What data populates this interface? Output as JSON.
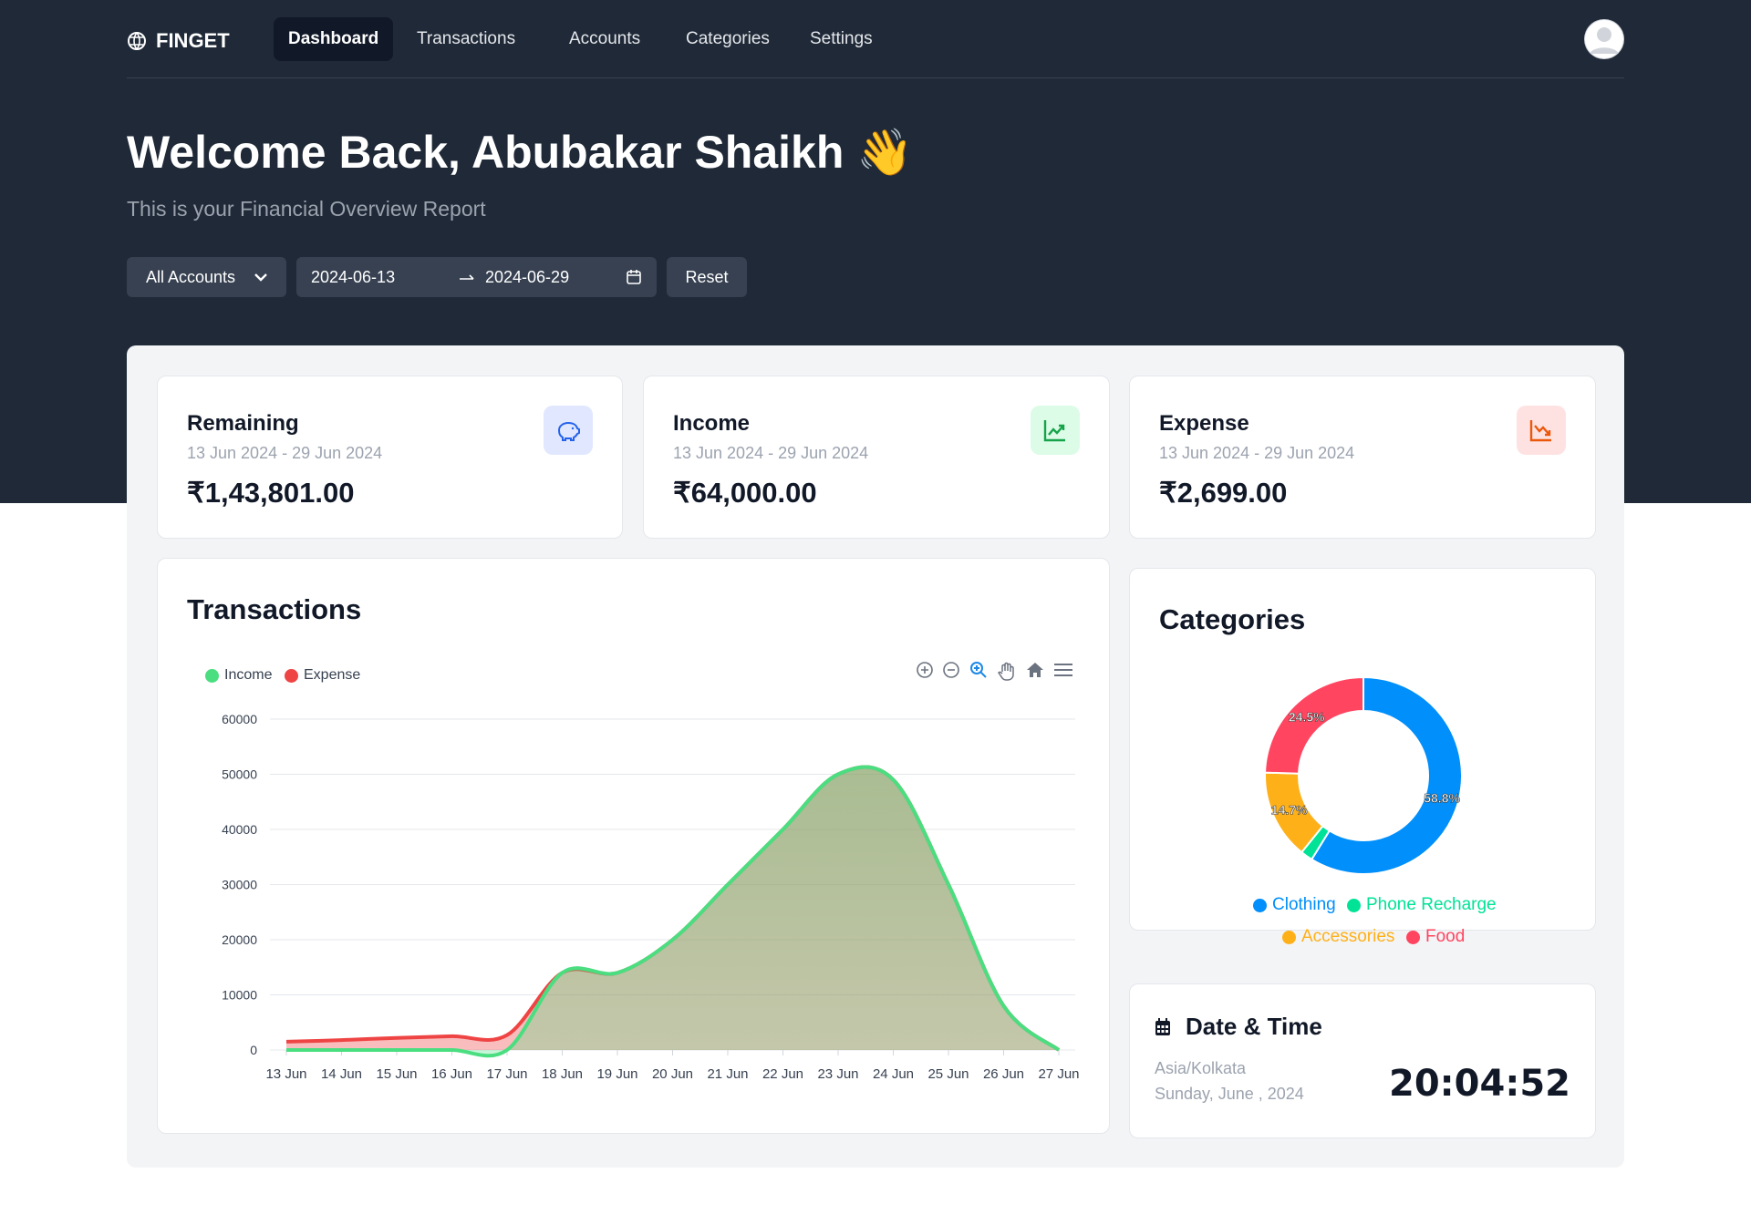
{
  "app": {
    "name": "FINGET"
  },
  "nav": {
    "items": [
      "Dashboard",
      "Transactions",
      "Accounts",
      "Categories",
      "Settings"
    ],
    "active": "Dashboard"
  },
  "header": {
    "title": "Welcome Back, Abubakar Shaikh 👋",
    "subtitle": "This is your Financial Overview Report"
  },
  "filters": {
    "account": "All Accounts",
    "start_date": "2024-06-13",
    "end_date": "2024-06-29",
    "reset_label": "Reset"
  },
  "stats": [
    {
      "title": "Remaining",
      "range": "13 Jun 2024 - 29 Jun 2024",
      "value": "₹1,43,801.00",
      "icon": "piggy-bank-icon",
      "color": "#2563eb",
      "bg": "#e0e7ff"
    },
    {
      "title": "Income",
      "range": "13 Jun 2024 - 29 Jun 2024",
      "value": "₹64,000.00",
      "icon": "trending-up-icon",
      "color": "#16a34a",
      "bg": "#dcfce7"
    },
    {
      "title": "Expense",
      "range": "13 Jun 2024 - 29 Jun 2024",
      "value": "₹2,699.00",
      "icon": "trending-down-icon",
      "color": "#ea580c",
      "bg": "#fee2e2"
    }
  ],
  "transactions": {
    "title": "Transactions"
  },
  "categories": {
    "title": "Categories"
  },
  "datetime": {
    "title": "Date & Time",
    "timezone": "Asia/Kolkata",
    "date": "Sunday, June , 2024",
    "time": "20:04:52"
  },
  "chart_data": [
    {
      "type": "area",
      "title": "",
      "x": [
        "13 Jun",
        "14 Jun",
        "15 Jun",
        "16 Jun",
        "17 Jun",
        "18 Jun",
        "19 Jun",
        "20 Jun",
        "21 Jun",
        "22 Jun",
        "23 Jun",
        "24 Jun",
        "25 Jun",
        "26 Jun",
        "27 Jun"
      ],
      "series": [
        {
          "name": "Income",
          "color": "#4ade80",
          "values": [
            0,
            0,
            0,
            0,
            0,
            14000,
            14000,
            20000,
            30000,
            40000,
            50000,
            49000,
            30000,
            8000,
            0
          ]
        },
        {
          "name": "Expense",
          "color": "#ef4444",
          "values": [
            1500,
            1800,
            2200,
            2500,
            2700,
            14000,
            14000,
            20000,
            30000,
            40000,
            50000,
            49000,
            30000,
            8000,
            0
          ]
        }
      ],
      "yticks": [
        0,
        10000,
        20000,
        30000,
        40000,
        50000,
        60000
      ],
      "ylim": [
        0,
        60000
      ],
      "grid": true,
      "legend": "top-left"
    },
    {
      "type": "pie",
      "donut": true,
      "title": "",
      "slices": [
        {
          "label": "Clothing",
          "value": 58.8,
          "color": "#008ffb",
          "text": "58.8%"
        },
        {
          "label": "Phone Recharge",
          "value": 2.0,
          "color": "#00e396",
          "text": ""
        },
        {
          "label": "Accessories",
          "value": 14.7,
          "color": "#feb019",
          "text": "14.7%"
        },
        {
          "label": "Food",
          "value": 24.5,
          "color": "#ff4560",
          "text": "24.5%"
        }
      ],
      "legend": "bottom"
    }
  ]
}
